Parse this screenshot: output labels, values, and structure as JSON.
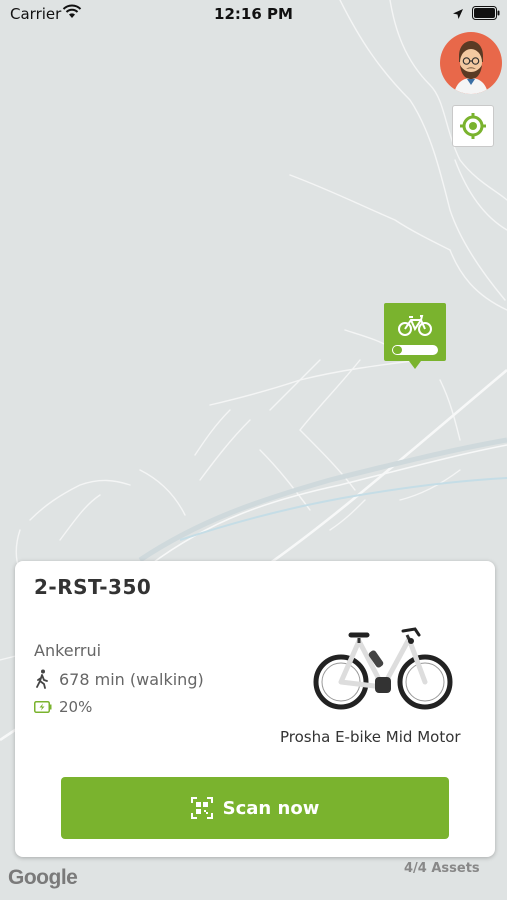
{
  "status_bar": {
    "carrier": "Carrier",
    "time": "12:16 PM"
  },
  "map": {
    "marker": {
      "battery_fill": 0.2,
      "icon": "bicycle-icon"
    },
    "attribution": "Google",
    "assets_count": "4/4 Assets"
  },
  "card": {
    "asset_id": "2-RST-350",
    "location": "Ankerrui",
    "walking_time": "678 min (walking)",
    "battery": "20%",
    "bike_name": "Prosha E-bike Mid Motor",
    "scan_button": "Scan now"
  },
  "colors": {
    "accent": "#7ab32e",
    "avatar_bg": "#e8684a"
  }
}
